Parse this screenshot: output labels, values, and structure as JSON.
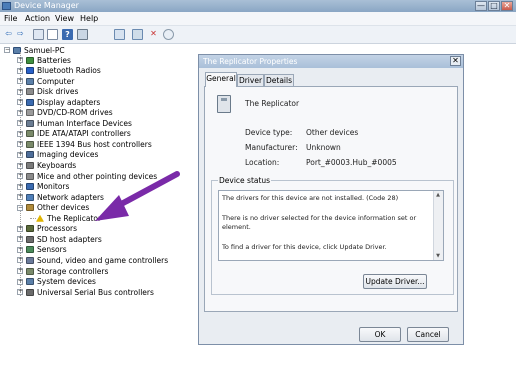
{
  "window": {
    "title": "Device Manager",
    "controls": [
      "—",
      "□",
      "✕"
    ]
  },
  "menubar": {
    "items": [
      "File",
      "Action",
      "View",
      "Help"
    ]
  },
  "toolbar": {
    "icons": [
      "back-icon",
      "forward-icon",
      "tree-view-icon",
      "properties-icon",
      "help-icon",
      "display-icon",
      "scan-hardware-icon",
      "uninstall-icon",
      "disable-icon"
    ],
    "glyphs": [
      "⇦",
      "⇨",
      "",
      "",
      "?",
      "",
      "",
      "",
      ""
    ]
  },
  "tree": {
    "root": "Samuel-PC",
    "items": [
      {
        "label": "Batteries",
        "icon": "battery-icon",
        "color": "#3f8f3f",
        "expanded": false
      },
      {
        "label": "Bluetooth Radios",
        "icon": "bluetooth-icon",
        "color": "#2860c8",
        "expanded": false
      },
      {
        "label": "Computer",
        "icon": "computer-icon",
        "color": "#5b7fa8",
        "expanded": false
      },
      {
        "label": "Disk drives",
        "icon": "disk-icon",
        "color": "#8c8c8c",
        "expanded": false
      },
      {
        "label": "Display adapters",
        "icon": "display-adapter-icon",
        "color": "#3a6ab0",
        "expanded": false
      },
      {
        "label": "DVD/CD-ROM drives",
        "icon": "dvd-icon",
        "color": "#9a9a9a",
        "expanded": false
      },
      {
        "label": "Human Interface Devices",
        "icon": "hid-icon",
        "color": "#6a7c92",
        "expanded": false
      },
      {
        "label": "IDE ATA/ATAPI controllers",
        "icon": "ide-icon",
        "color": "#7a8a6a",
        "expanded": false
      },
      {
        "label": "IEEE 1394 Bus host controllers",
        "icon": "ieee1394-icon",
        "color": "#7a8a6a",
        "expanded": false
      },
      {
        "label": "Imaging devices",
        "icon": "camera-icon",
        "color": "#4d6d99",
        "expanded": false
      },
      {
        "label": "Keyboards",
        "icon": "keyboard-icon",
        "color": "#7b7b7b",
        "expanded": false
      },
      {
        "label": "Mice and other pointing devices",
        "icon": "mouse-icon",
        "color": "#8a8a8a",
        "expanded": false
      },
      {
        "label": "Monitors",
        "icon": "monitor-icon",
        "color": "#3a6ab0",
        "expanded": false
      },
      {
        "label": "Network adapters",
        "icon": "network-icon",
        "color": "#4f7fb8",
        "expanded": false
      },
      {
        "label": "Other devices",
        "icon": "other-devices-icon",
        "color": "#b08a3a",
        "expanded": true
      },
      {
        "label": "The Replicator",
        "icon": "warning-device-icon",
        "color": "#e0b400",
        "child": true
      },
      {
        "label": "Processors",
        "icon": "processor-icon",
        "color": "#5a6a3a",
        "expanded": false
      },
      {
        "label": "SD host adapters",
        "icon": "sd-icon",
        "color": "#6a6a6a",
        "expanded": false
      },
      {
        "label": "Sensors",
        "icon": "sensor-icon",
        "color": "#4a8a5a",
        "expanded": false
      },
      {
        "label": "Sound, video and game controllers",
        "icon": "sound-icon",
        "color": "#6a7a9a",
        "expanded": false
      },
      {
        "label": "Storage controllers",
        "icon": "storage-icon",
        "color": "#7a8a6a",
        "expanded": false
      },
      {
        "label": "System devices",
        "icon": "system-icon",
        "color": "#5b7fa8",
        "expanded": false
      },
      {
        "label": "Universal Serial Bus controllers",
        "icon": "usb-icon",
        "color": "#6a6a6a",
        "expanded": false
      }
    ]
  },
  "annotation": {
    "arrow_color": "#7a2aa8"
  },
  "dialog": {
    "title": "The Replicator Properties",
    "close": "✕",
    "tabs": [
      "General",
      "Driver",
      "Details"
    ],
    "device_name": "The Replicator",
    "device_type_label": "Device type:",
    "device_type_value": "Other devices",
    "manufacturer_label": "Manufacturer:",
    "manufacturer_value": "Unknown",
    "location_label": "Location:",
    "location_value": "Port_#0003.Hub_#0005",
    "status_group_label": "Device status",
    "status_lines": [
      "The drivers for this device are not installed. (Code 28)",
      "",
      "There is no driver selected for the device information set or",
      "element.",
      "",
      "To find a driver for this device, click Update Driver."
    ],
    "update_driver_label": "Update Driver...",
    "ok_label": "OK",
    "cancel_label": "Cancel"
  }
}
